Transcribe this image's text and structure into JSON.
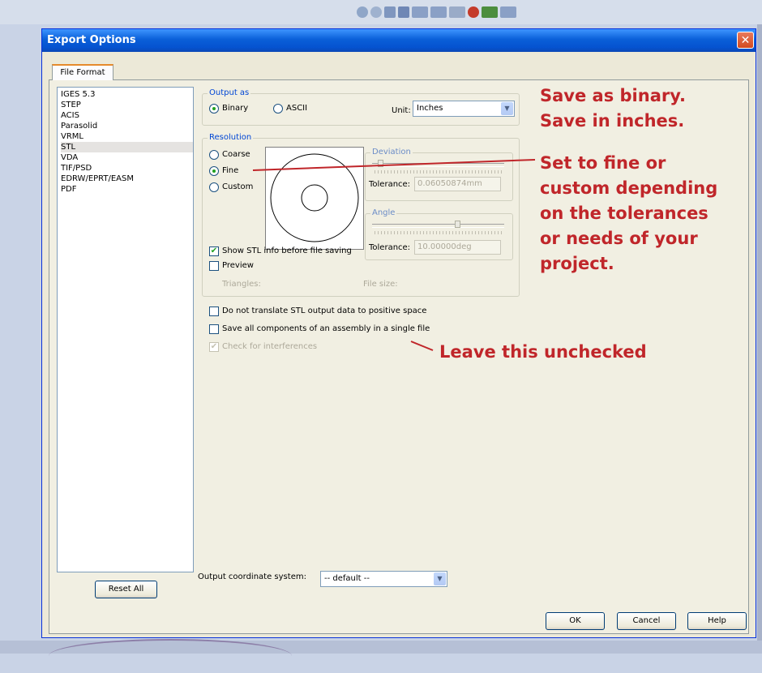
{
  "dialog": {
    "title": "Export Options",
    "close_glyph": "✕"
  },
  "tab": {
    "label": "File Format"
  },
  "formats": [
    {
      "label": "IGES 5.3"
    },
    {
      "label": "STEP"
    },
    {
      "label": "ACIS"
    },
    {
      "label": "Parasolid"
    },
    {
      "label": "VRML"
    },
    {
      "label": "STL",
      "selected": true
    },
    {
      "label": "VDA"
    },
    {
      "label": "TIF/PSD"
    },
    {
      "label": "EDRW/EPRT/EASM"
    },
    {
      "label": "PDF"
    }
  ],
  "reset_all": "Reset All",
  "output_as": {
    "legend": "Output as",
    "binary": "Binary",
    "ascii": "ASCII",
    "selected": "binary",
    "unit_label": "Unit:",
    "unit_value": "Inches"
  },
  "resolution": {
    "legend": "Resolution",
    "coarse": "Coarse",
    "fine": "Fine",
    "custom": "Custom",
    "selected": "fine"
  },
  "deviation": {
    "legend": "Deviation",
    "tolerance_label": "Tolerance:",
    "tolerance_value": "0.06050874mm"
  },
  "angle": {
    "legend": "Angle",
    "tolerance_label": "Tolerance:",
    "tolerance_value": "10.00000deg"
  },
  "show_info": {
    "label": "Show STL info before file saving",
    "checked": true
  },
  "preview": {
    "label": "Preview",
    "checked": false
  },
  "triangles_label": "Triangles:",
  "filesize_label": "File size:",
  "no_translate": {
    "label": "Do not translate STL output data to positive space",
    "checked": false
  },
  "save_all": {
    "label": "Save all components of an assembly in a single file",
    "checked": false
  },
  "check_interf": {
    "label": "Check for interferences",
    "checked": true,
    "disabled": true
  },
  "coord": {
    "label": "Output coordinate system:",
    "value": "-- default --"
  },
  "buttons": {
    "ok": "OK",
    "cancel": "Cancel",
    "help": "Help"
  },
  "annotations": {
    "binary_line1": "Save as binary.",
    "binary_line2": "Save in inches.",
    "fine_lines": [
      "Set to fine or",
      "custom depending",
      "on the tolerances",
      "or needs of your",
      "project."
    ],
    "unchecked": "Leave this unchecked",
    "color": "#c0262a"
  },
  "colors": {
    "title_bar": "#0a5fd8",
    "dialog_bg": "#ece9d8",
    "legend_text": "#0046d5"
  },
  "toolbar_icons": [
    "zoom-to-fit-icon",
    "zoom-area-icon",
    "previous-view-icon",
    "section-view-icon",
    "view-orientation-icon",
    "display-style-icon",
    "hide-show-icon",
    "appearance-icon",
    "scene-icon",
    "view-settings-icon"
  ]
}
